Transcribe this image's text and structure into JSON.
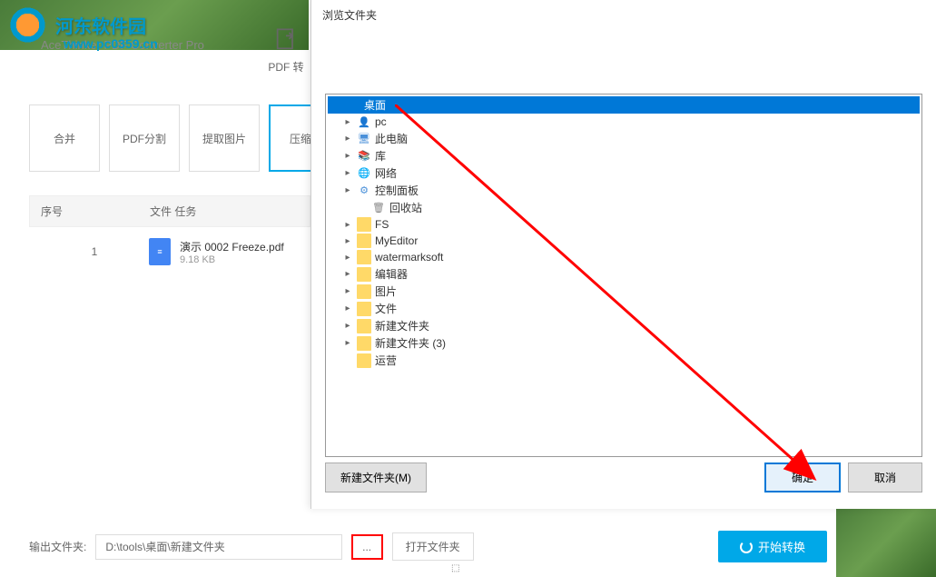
{
  "logo": {
    "text": "河东软件园"
  },
  "app_title": "AceThinker PDF Converter Pro",
  "watermark": "www.pc0359.cn",
  "pdf_convert": {
    "label": "PDF 转"
  },
  "tabs": {
    "merge": "合并",
    "split": "PDF分割",
    "extract": "提取图片",
    "compress": "压缩P"
  },
  "table": {
    "header_seq": "序号",
    "header_file": "文件 任务",
    "row1": {
      "seq": "1",
      "name": "演示 0002 Freeze.pdf",
      "size": "9.18 KB"
    }
  },
  "dialog": {
    "title": "浏览文件夹",
    "tree": {
      "desktop": "桌面",
      "pc": "pc",
      "this_pc": "此电脑",
      "lib": "库",
      "network": "网络",
      "control_panel": "控制面板",
      "recycle_bin": "回收站",
      "fs": "FS",
      "myeditor": "MyEditor",
      "watermarksoft": "watermarksoft",
      "editor": "编辑器",
      "pictures": "图片",
      "files": "文件",
      "new_folder": "新建文件夹",
      "new_folder_3": "新建文件夹 (3)",
      "yunying": "运营"
    },
    "new_folder_btn": "新建文件夹(M)",
    "ok_btn": "确定",
    "cancel_btn": "取消"
  },
  "bottom": {
    "output_label": "输出文件夹:",
    "output_path": "D:\\tools\\桌面\\新建文件夹",
    "browse": "...",
    "open_folder": "打开文件夹",
    "start": "开始转换"
  },
  "handle": "⬚"
}
